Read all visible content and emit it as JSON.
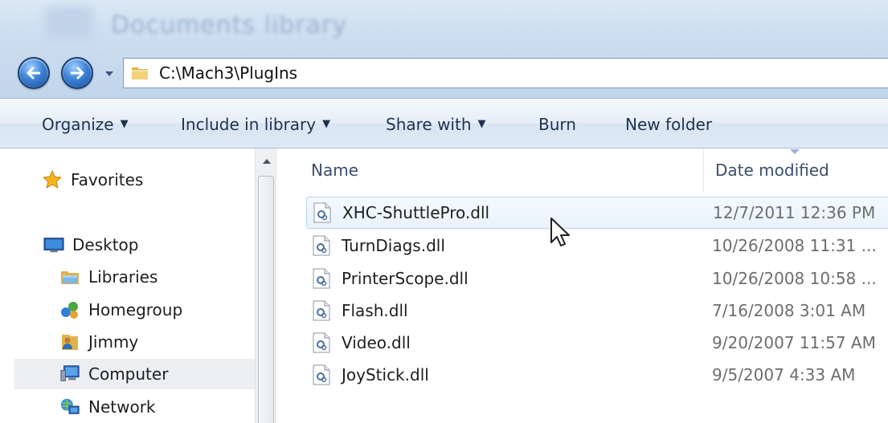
{
  "window": {
    "title": "Documents library"
  },
  "address_bar": {
    "path": "C:\\Mach3\\PlugIns"
  },
  "toolbar": {
    "organize": "Organize",
    "include_in_library": "Include in library",
    "share_with": "Share with",
    "burn": "Burn",
    "new_folder": "New folder"
  },
  "nav_pane": {
    "favorites": "Favorites",
    "desktop": "Desktop",
    "libraries": "Libraries",
    "homegroup": "Homegroup",
    "jimmy": "Jimmy",
    "computer": "Computer",
    "network": "Network",
    "selected": "Computer"
  },
  "file_list": {
    "columns": {
      "name": "Name",
      "date_modified": "Date modified"
    },
    "files": [
      {
        "name": "XHC-ShuttlePro.dll",
        "date": "12/7/2011 12:36 PM"
      },
      {
        "name": "TurnDiags.dll",
        "date": "10/26/2008 11:31 ..."
      },
      {
        "name": "PrinterScope.dll",
        "date": "10/26/2008 10:58 ..."
      },
      {
        "name": "Flash.dll",
        "date": "7/16/2008 3:01 AM"
      },
      {
        "name": "Video.dll",
        "date": "9/20/2007 11:57 AM"
      },
      {
        "name": "JoyStick.dll",
        "date": "9/5/2007 4:33 AM"
      }
    ],
    "hovered_file": "XHC-ShuttlePro.dll"
  },
  "icons": {
    "back": "back-arrow-icon",
    "forward": "forward-arrow-icon",
    "folder": "folder-icon",
    "file": "dll-file-icon",
    "cursor": "mouse-pointer-icon"
  },
  "colors": {
    "toolbar_text": "#1e3250",
    "hover_border": "#b7d3f0",
    "date_text": "#6d6d6d"
  }
}
